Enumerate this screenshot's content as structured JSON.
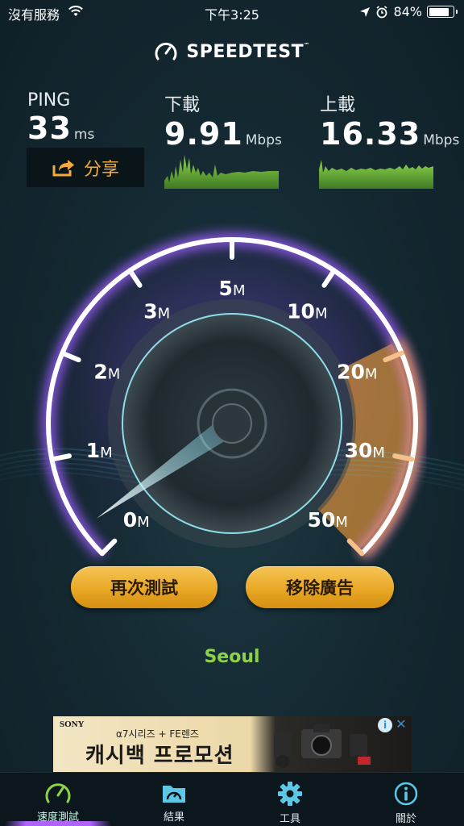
{
  "status_bar": {
    "carrier": "沒有服務",
    "time": "下午3:25",
    "battery_percent": "84%",
    "battery_level": 0.84
  },
  "brand": {
    "name": "SPEEDTEST",
    "trademark": "™"
  },
  "metrics": {
    "ping": {
      "label": "PING",
      "value": "33",
      "unit": "ms"
    },
    "download": {
      "label": "下載",
      "value": "9.91",
      "unit": "Mbps"
    },
    "upload": {
      "label": "上載",
      "value": "16.33",
      "unit": "Mbps"
    }
  },
  "share": {
    "label": "分享"
  },
  "gauge": {
    "ticks": [
      {
        "num": "0",
        "unit": "M"
      },
      {
        "num": "1",
        "unit": "M"
      },
      {
        "num": "2",
        "unit": "M"
      },
      {
        "num": "3",
        "unit": "M"
      },
      {
        "num": "5",
        "unit": "M"
      },
      {
        "num": "10",
        "unit": "M"
      },
      {
        "num": "20",
        "unit": "M"
      },
      {
        "num": "30",
        "unit": "M"
      },
      {
        "num": "50",
        "unit": "M"
      }
    ],
    "needle_value_mbps": 0,
    "highlight_from_tick_index": 6,
    "colors": {
      "track": "#ffffff",
      "glow": "#9b5cff",
      "highlight": "#e99a3a"
    }
  },
  "buttons": {
    "retest": "再次測試",
    "remove_ads": "移除廣告"
  },
  "server": {
    "name": "Seoul"
  },
  "ad": {
    "brand": "SONY",
    "tagline": "α7시리즈 + FE렌즈",
    "headline": "캐시백 프로모션",
    "adchoices_icon": "info-icon",
    "close_icon": "close-icon"
  },
  "tabs": [
    {
      "label": "速度測試",
      "icon": "speedometer-icon",
      "active": true
    },
    {
      "label": "結果",
      "icon": "folder-results-icon",
      "active": false
    },
    {
      "label": "工具",
      "icon": "gear-icon",
      "active": false
    },
    {
      "label": "關於",
      "icon": "info-icon",
      "active": false
    }
  ],
  "colors": {
    "accent_orange": "#f4a93a",
    "accent_green": "#8fd24a",
    "tab_active": "#b062ff"
  }
}
